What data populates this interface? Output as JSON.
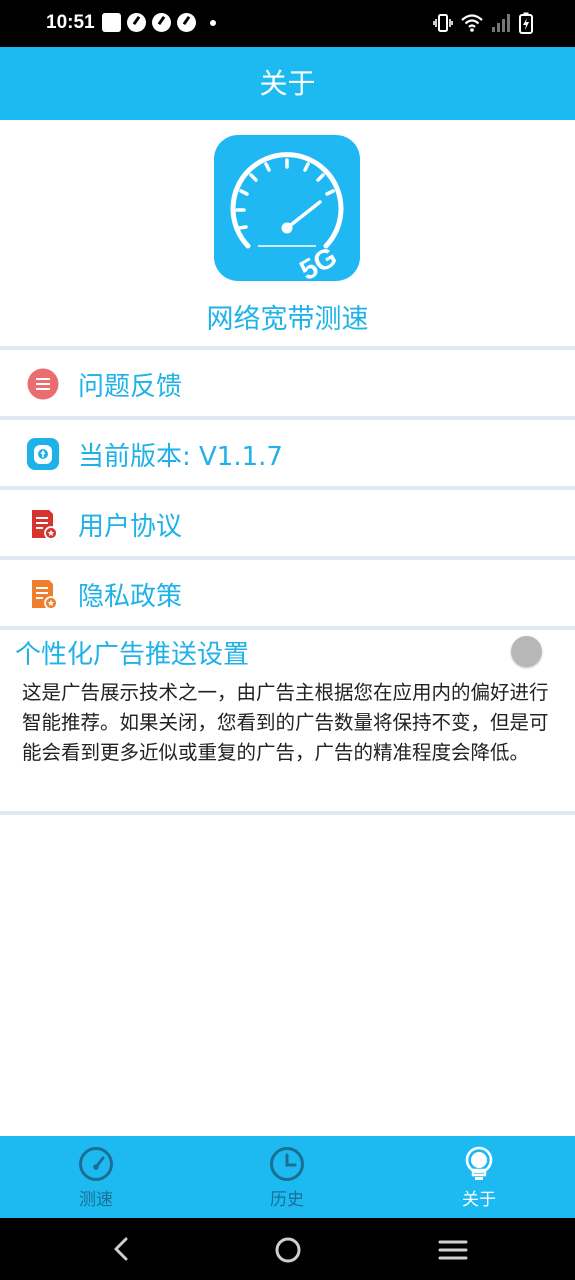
{
  "status_bar": {
    "time": "10:51"
  },
  "header": {
    "title": "关于"
  },
  "app": {
    "name": "网络宽带测速",
    "logo_badge": "5G"
  },
  "menu": [
    {
      "label": "问题反馈",
      "icon": "feedback-icon"
    },
    {
      "label": "当前版本:  V1.1.7",
      "icon": "version-icon"
    },
    {
      "label": "用户协议",
      "icon": "user-agreement-icon"
    },
    {
      "label": "隐私政策",
      "icon": "privacy-policy-icon"
    }
  ],
  "ad_settings": {
    "title": "个性化广告推送设置",
    "enabled": false,
    "description": "这是广告展示技术之一，由广告主根据您在应用内的偏好进行智能推荐。如果关闭，您看到的广告数量将保持不变，但是可能会看到更多近似或重复的广告，广告的精准程度会降低。"
  },
  "bottom_nav": [
    {
      "label": "测速",
      "icon": "speedometer-icon",
      "active": false
    },
    {
      "label": "历史",
      "icon": "clock-icon",
      "active": false
    },
    {
      "label": "关于",
      "icon": "lightbulb-icon",
      "active": true
    }
  ],
  "colors": {
    "primary": "#1dbaf2",
    "text_accent": "#1fb2e8",
    "nav_inactive": "#1a6f93",
    "nav_active": "#ffffff",
    "divider": "#dfe8f4"
  }
}
